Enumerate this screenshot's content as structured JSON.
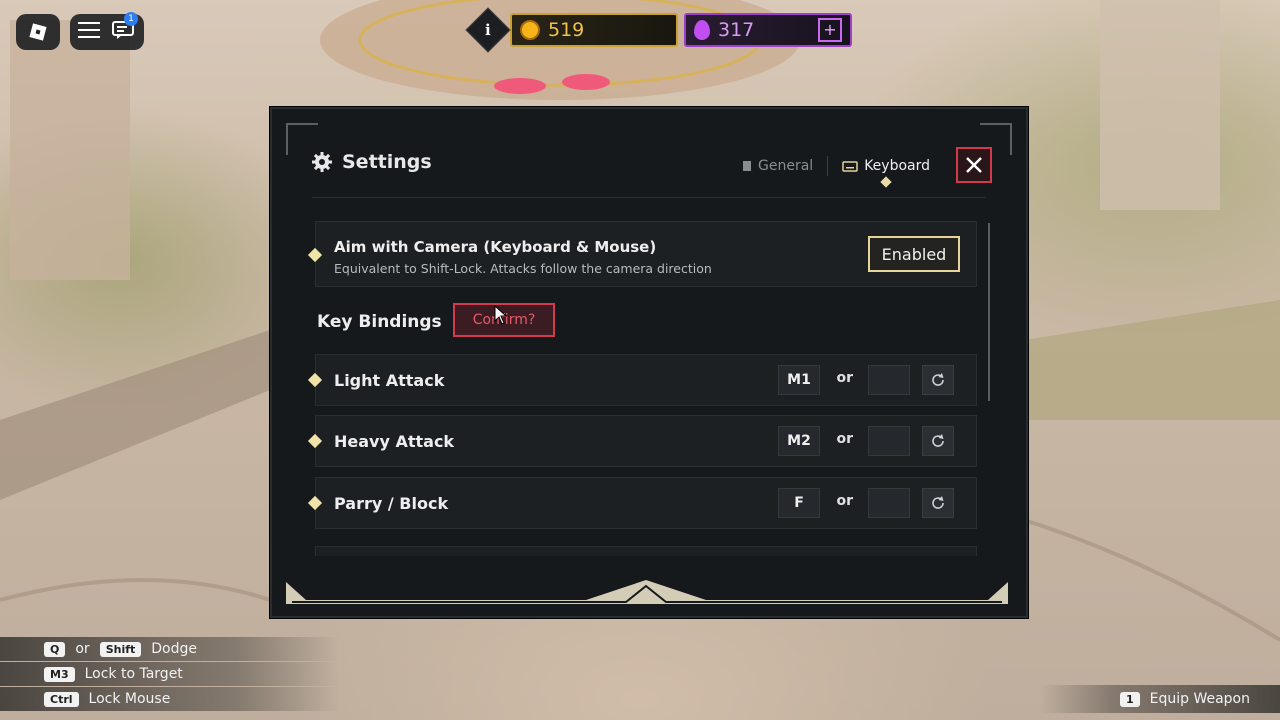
{
  "top": {
    "chat_badge_count": "1",
    "gold_amount": "519",
    "gem_amount": "317",
    "info_label": "i",
    "plus_label": "+"
  },
  "settings": {
    "title": "Settings",
    "tabs": [
      {
        "label": "General",
        "active": false
      },
      {
        "label": "Keyboard",
        "active": true
      }
    ],
    "aim_camera": {
      "title": "Aim with Camera (Keyboard & Mouse)",
      "description": "Equivalent to Shift-Lock. Attacks follow the camera direction",
      "toggle_label": "Enabled"
    },
    "key_bindings_label": "Key Bindings",
    "confirm_label": "Confirm?",
    "or_label": "or",
    "bindings": [
      {
        "name": "Light Attack",
        "primary": "M1",
        "secondary": ""
      },
      {
        "name": "Heavy Attack",
        "primary": "M2",
        "secondary": ""
      },
      {
        "name": "Parry / Block",
        "primary": "F",
        "secondary": ""
      }
    ]
  },
  "hud_hints": {
    "dodge": {
      "key1": "Q",
      "or": "or",
      "key2": "Shift",
      "label": "Dodge"
    },
    "lock_target": {
      "key": "M3",
      "label": "Lock to Target"
    },
    "lock_mouse": {
      "key": "Ctrl",
      "label": "Lock Mouse"
    },
    "equip": {
      "key": "1",
      "label": "Equip Weapon"
    }
  },
  "colors": {
    "accent_gold": "#e6d49a",
    "close_red": "#d2394a",
    "gold_currency": "#c9a031",
    "gem_currency": "#9d3fcc"
  }
}
